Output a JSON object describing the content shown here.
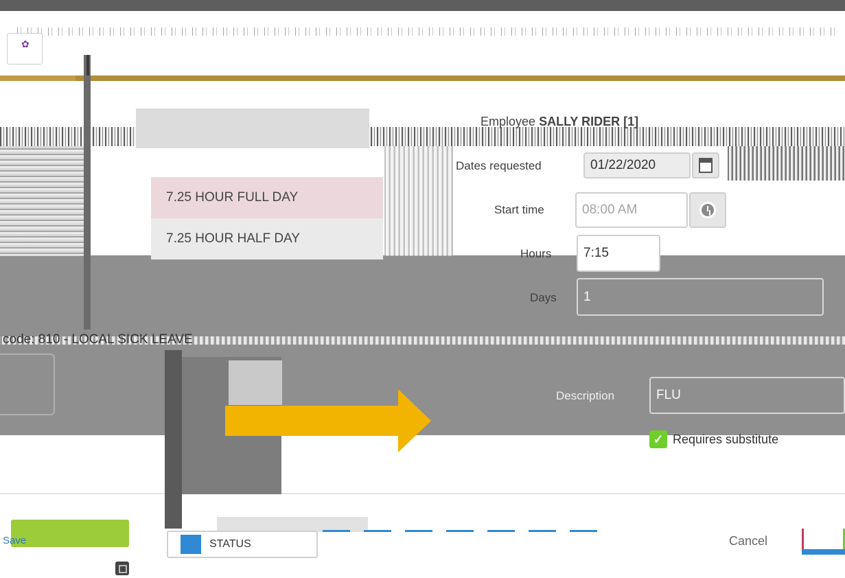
{
  "header": {
    "logo": "logo-icon"
  },
  "dropdown": {
    "options": [
      {
        "label": "7.25 HOUR FULL DAY",
        "selected": true
      },
      {
        "label": "7.25 HOUR HALF DAY",
        "selected": false
      }
    ]
  },
  "form": {
    "employee_label": "Employee",
    "employee_name": "SALLY RIDER [1]",
    "dates_label": "Dates requested",
    "dates_value": "01/22/2020",
    "start_time_label": "Start time",
    "start_time_value": "08:00 AM",
    "hours_label": "Hours",
    "hours_value": "7:15",
    "days_label": "Days",
    "days_value": "1",
    "description_label": "Description",
    "description_value": "FLU",
    "requires_substitute_label": "Requires substitute",
    "requires_substitute_checked": true,
    "time_code_text": "code: 810 - LOCAL SICK LEAVE"
  },
  "footer": {
    "save_label": "Save",
    "status_label": "STATUS",
    "cancel_label": "Cancel"
  },
  "colors": {
    "accent_gold": "#b08d3b",
    "save_green": "#9ccc3a",
    "check_green": "#6fcf2a",
    "arrow_orange": "#f2b400",
    "status_blue": "#2f89d4",
    "selected_row": "#ecd8dc"
  }
}
